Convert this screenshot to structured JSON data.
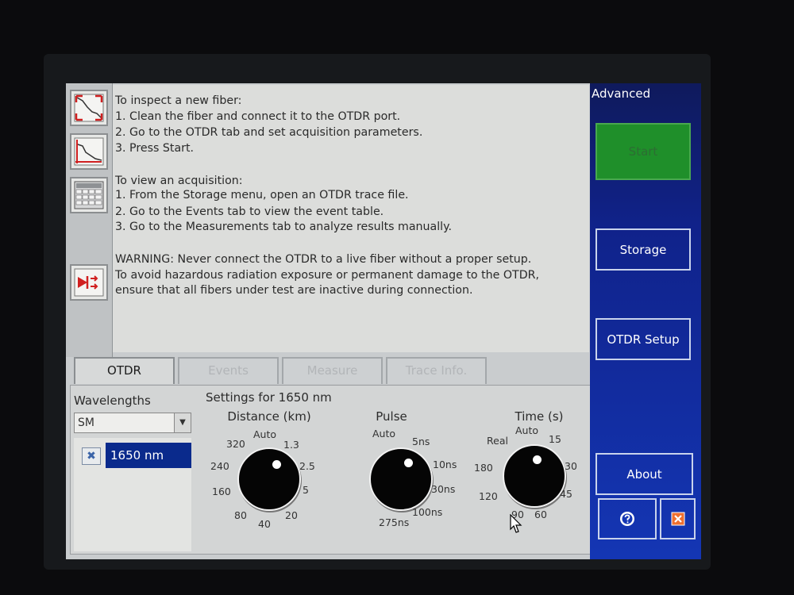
{
  "sidebar": {
    "title": "Advanced",
    "start_label": "Start",
    "storage_label": "Storage",
    "otdr_setup_label": "OTDR Setup",
    "about_label": "About"
  },
  "toolbar": {
    "icons": [
      "trace-overview-icon",
      "trace-zoom-icon",
      "event-table-icon",
      "laser-source-icon"
    ]
  },
  "info": {
    "lines": [
      "To inspect a new fiber:",
      "  1. Clean the fiber and connect it to the OTDR port.",
      "  2. Go to the OTDR tab and set acquisition parameters.",
      "  3. Press Start.",
      "",
      "To view an acquisition:",
      "  1. From the Storage menu, open an OTDR trace file.",
      "  2. Go to the Events tab to view the event table.",
      "  3. Go to the Measurements tab to analyze results manually.",
      "",
      "WARNING: Never connect the OTDR to a live fiber without a proper setup.",
      "To avoid hazardous radiation exposure or permanent damage to the OTDR,",
      "ensure that all fibers under test are inactive during connection."
    ]
  },
  "tabs": [
    {
      "label": "OTDR",
      "active": true
    },
    {
      "label": "Events",
      "active": false
    },
    {
      "label": "Measure",
      "active": false
    },
    {
      "label": "Trace Info.",
      "active": false
    }
  ],
  "wavelengths": {
    "label": "Wavelengths",
    "mode": "SM",
    "items": [
      "1650 nm"
    ]
  },
  "settings": {
    "title": "Settings for 1650 nm",
    "distance": {
      "title": "Distance (km)",
      "ticks": [
        "Auto",
        "1.3",
        "2.5",
        "5",
        "20",
        "40",
        "80",
        "160",
        "240",
        "320"
      ]
    },
    "pulse": {
      "title": "Pulse",
      "ticks": [
        "Auto",
        "5ns",
        "10ns",
        "30ns",
        "100ns",
        "275ns"
      ]
    },
    "time": {
      "title": "Time (s)",
      "ticks": [
        "Auto",
        "15",
        "30",
        "45",
        "60",
        "90",
        "120",
        "180",
        "Real"
      ]
    }
  },
  "colors": {
    "side_panel": "#1436b4",
    "start_button": "#1f8f2a",
    "selection": "#0a2a8c",
    "close_icon": "#f07030",
    "toolbar_icon_red": "#d02020"
  }
}
